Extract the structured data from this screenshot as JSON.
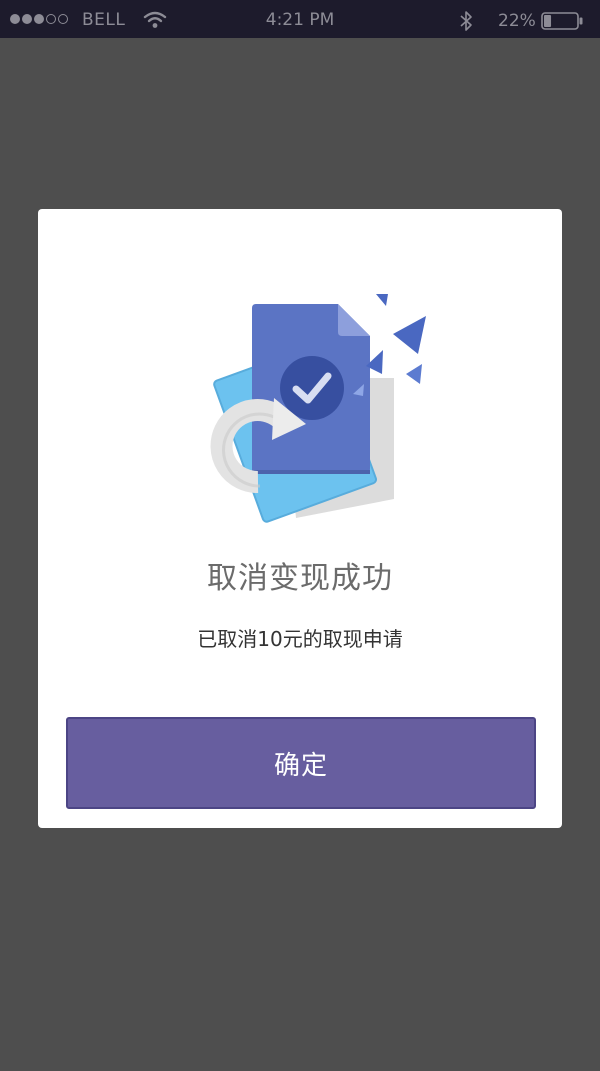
{
  "status_bar": {
    "carrier": "BELL",
    "time": "4:21 PM",
    "battery_percent": "22%",
    "signal_bars_filled": 3,
    "signal_bars_total": 5,
    "battery_level": 0.22
  },
  "dialog": {
    "title": "取消变现成功",
    "message": "已取消10元的取现申请",
    "confirm_label": "确定",
    "illustration_icon": "document-refund-check-icon"
  },
  "colors": {
    "status_bar_bg": "#1d1b2c",
    "overlay_bg": "#4e4e4e",
    "dialog_bg": "#ffffff",
    "button_bg": "#675e9f",
    "document_blue": "#5b74c4",
    "document_light_blue": "#6fc3f0"
  }
}
